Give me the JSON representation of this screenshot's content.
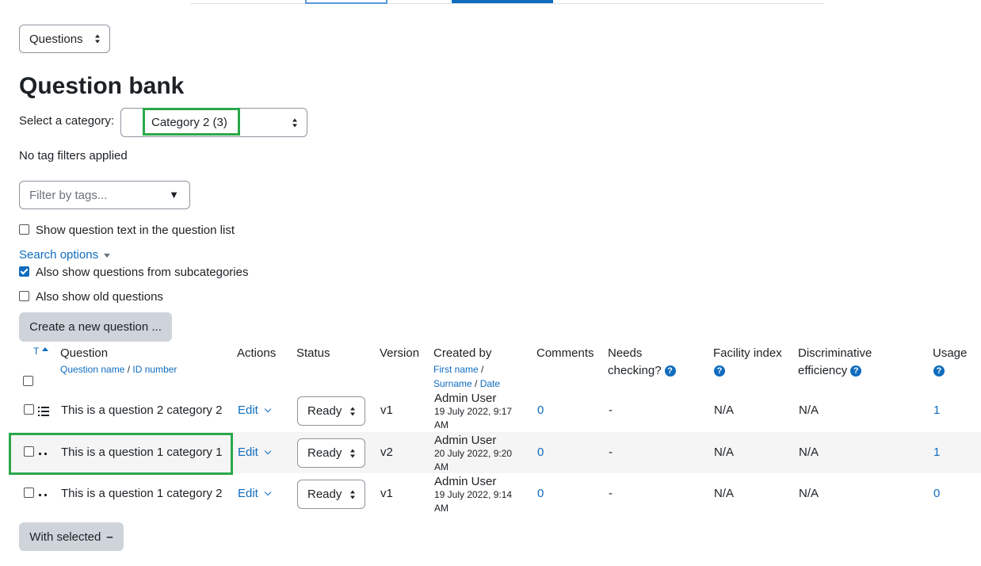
{
  "nav": {
    "select_value": "Questions"
  },
  "page_title": "Question bank",
  "category": {
    "label": "Select a category:",
    "value": "Category 2 (3)"
  },
  "tags": {
    "status": "No tag filters applied",
    "placeholder": "Filter by tags...",
    "arrow": "▼"
  },
  "show_text_label": "Show question text in the question list",
  "search_options_label": "Search options",
  "subcategories_label": "Also show questions from subcategories",
  "old_label": "Also show old questions",
  "create_button": "Create a new question ...",
  "table": {
    "sort_t": "T",
    "headers": {
      "question": "Question",
      "question_sub1": "Question name",
      "question_sep": " / ",
      "question_sub2": "ID number",
      "actions": "Actions",
      "status": "Status",
      "version": "Version",
      "created_by": "Created by",
      "created_sub1": "First name",
      "created_sep1": " /",
      "created_sub2": "Surname",
      "created_sep2": " / ",
      "created_sub3": "Date",
      "comments": "Comments",
      "needs1": "Needs",
      "needs2": "checking?",
      "facility": "Facility index",
      "disc1": "Discriminative",
      "disc2": "efficiency",
      "usage": "Usage",
      "help_glyph": "?"
    },
    "rows": [
      {
        "name": "This is a question 2 category 2",
        "icon": "multichoice-list-icon",
        "edit": "Edit",
        "status": "Ready",
        "version": "v1",
        "creator": "Admin User",
        "date1": "19 July 2022, 9:17",
        "date2": "AM",
        "comments": "0",
        "needs": "-",
        "facility": "N/A",
        "disc": "N/A",
        "usage": "1"
      },
      {
        "name": "This is a question 1 category 1",
        "icon": "short-answer-icon",
        "edit": "Edit",
        "status": "Ready",
        "version": "v2",
        "creator": "Admin User",
        "date1": "20 July 2022, 9:20",
        "date2": "AM",
        "comments": "0",
        "needs": "-",
        "facility": "N/A",
        "disc": "N/A",
        "usage": "1"
      },
      {
        "name": "This is a question 1 category 2",
        "icon": "short-answer-icon",
        "edit": "Edit",
        "status": "Ready",
        "version": "v1",
        "creator": "Admin User",
        "date1": "19 July 2022, 9:14",
        "date2": "AM",
        "comments": "0",
        "needs": "-",
        "facility": "N/A",
        "disc": "N/A",
        "usage": "0"
      }
    ]
  },
  "with_selected": "With selected",
  "with_selected_icon": "–",
  "colors": {
    "link": "#0f6cbf",
    "highlight": "#2aa84a",
    "button_bg": "#ced4da"
  }
}
